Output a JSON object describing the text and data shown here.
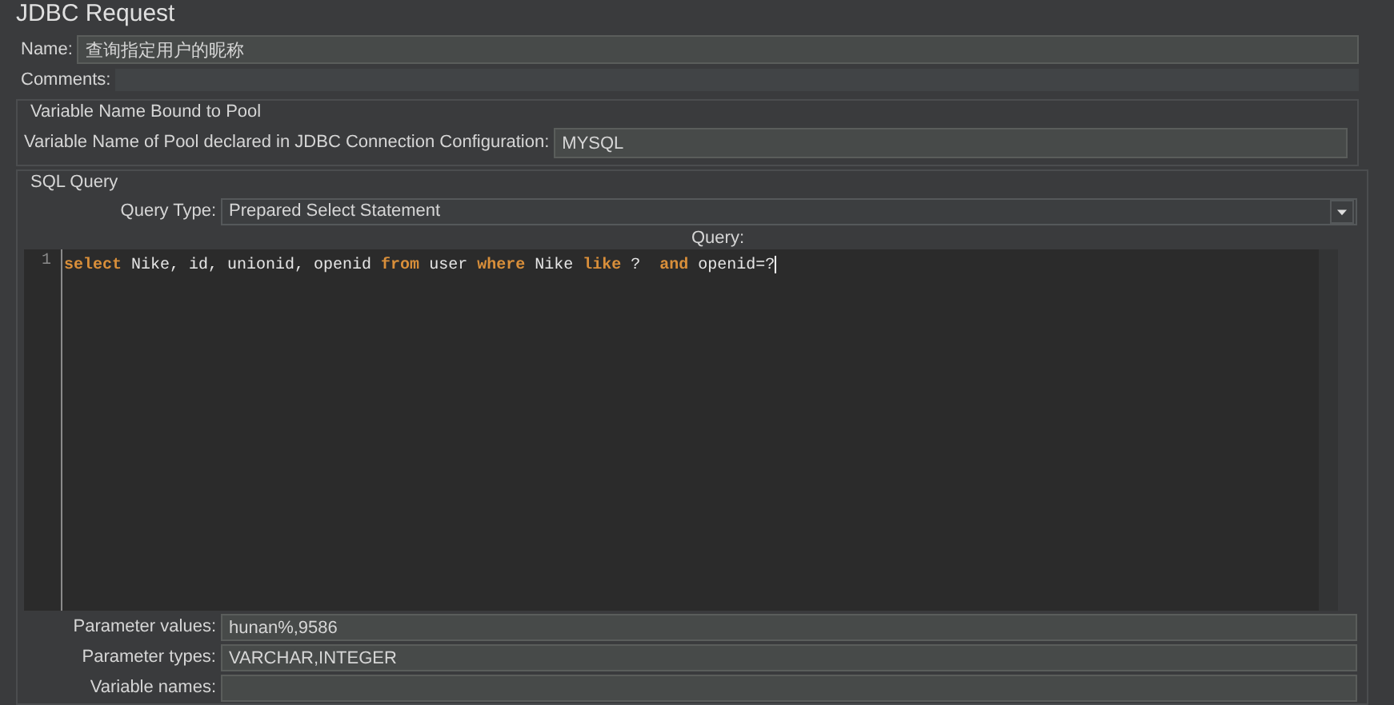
{
  "title": "JDBC Request",
  "name": {
    "label": "Name:",
    "value": "查询指定用户的昵称"
  },
  "comments": {
    "label": "Comments:"
  },
  "pool_group": {
    "title": "Variable Name Bound to Pool",
    "label": "Variable Name of Pool declared in JDBC Connection Configuration:",
    "value": "MYSQL"
  },
  "sql_group": {
    "title": "SQL Query",
    "query_type": {
      "label": "Query Type:",
      "value": "Prepared Select Statement"
    },
    "query_label": "Query:",
    "editor": {
      "line_number": "1",
      "tokens": [
        {
          "kind": "keyword",
          "text": "select"
        },
        {
          "kind": "text",
          "text": " Nike, id, unionid, openid "
        },
        {
          "kind": "keyword",
          "text": "from"
        },
        {
          "kind": "text",
          "text": " user "
        },
        {
          "kind": "keyword",
          "text": "where"
        },
        {
          "kind": "text",
          "text": " Nike "
        },
        {
          "kind": "keyword",
          "text": "like"
        },
        {
          "kind": "text",
          "text": " ?  "
        },
        {
          "kind": "keyword",
          "text": "and"
        },
        {
          "kind": "text",
          "text": " openid=?"
        }
      ]
    },
    "params": [
      {
        "label": "Parameter values:",
        "value": "hunan%,9586"
      },
      {
        "label": "Parameter types:",
        "value": "VARCHAR,INTEGER"
      },
      {
        "label": "Variable names:"
      }
    ]
  }
}
